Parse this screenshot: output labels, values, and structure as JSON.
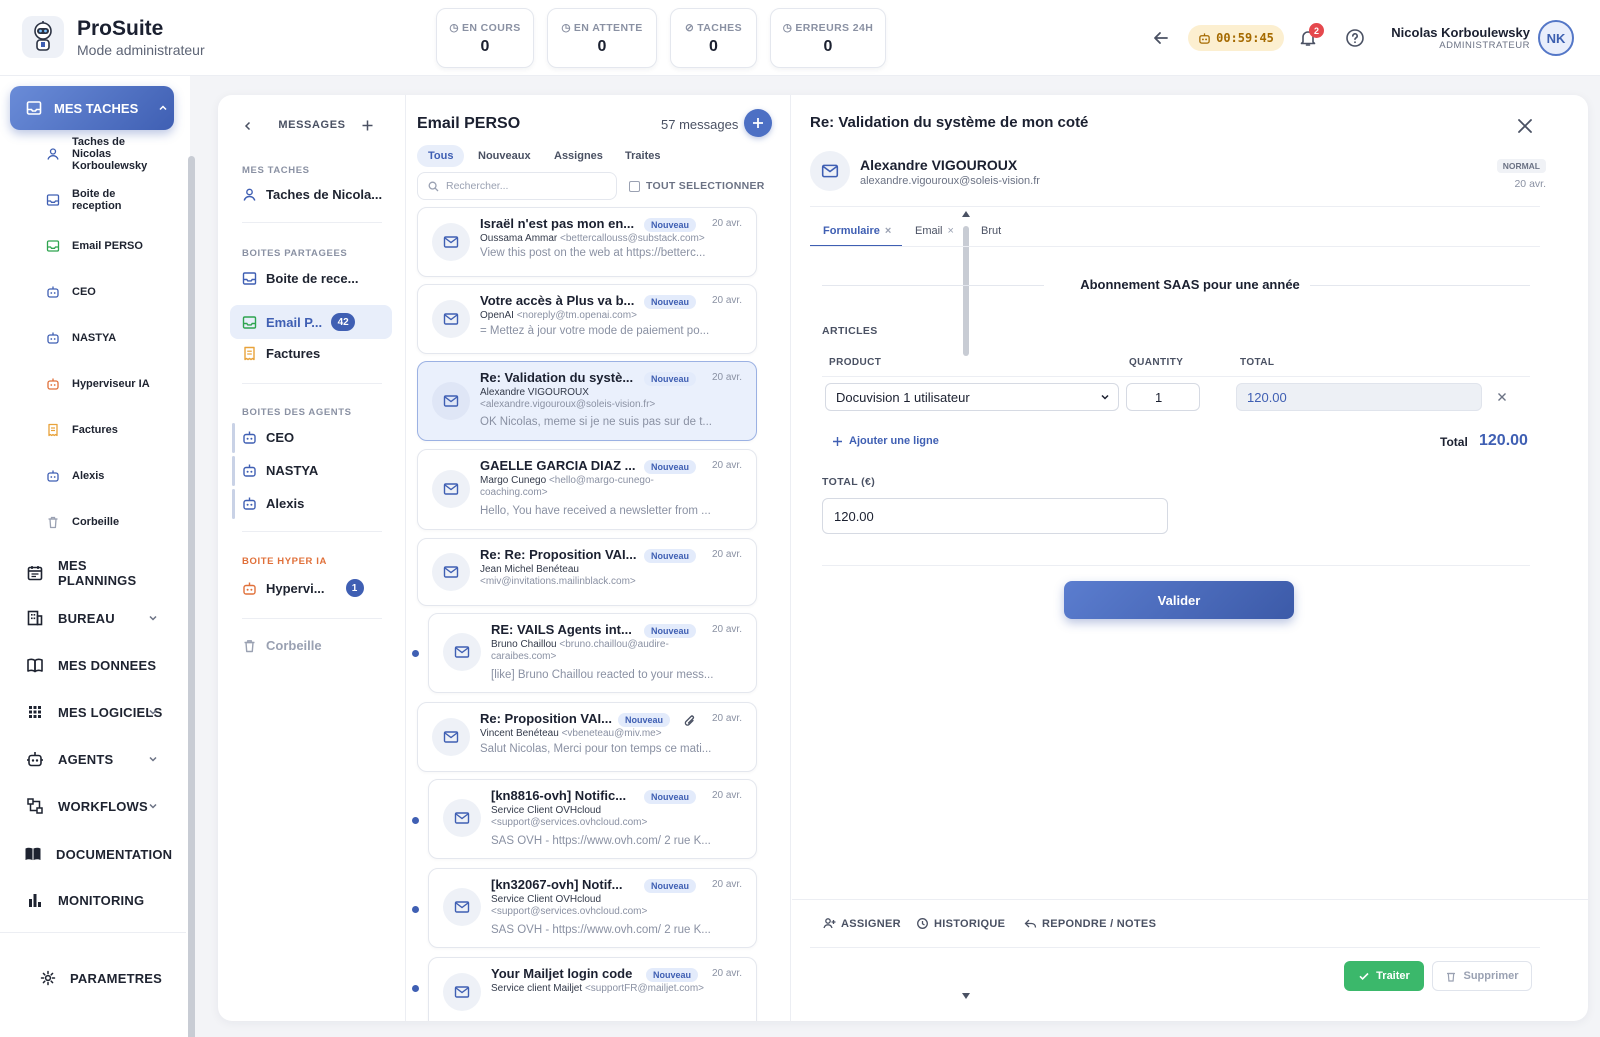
{
  "app": {
    "name": "ProSuite",
    "mode": "Mode administrateur"
  },
  "stats": [
    {
      "label": "EN COURS",
      "value": "0"
    },
    {
      "label": "EN ATTENTE",
      "value": "0"
    },
    {
      "label": "TACHES",
      "value": "0"
    },
    {
      "label": "ERREURS 24H",
      "value": "0"
    }
  ],
  "header": {
    "timer": "00:59:45",
    "notifications": "2",
    "user_name": "Nicolas Korboulewsky",
    "user_role": "ADMINISTRATEUR",
    "user_initials": "NK"
  },
  "sidebar": {
    "main": "MES TACHES",
    "sub_items": [
      {
        "label": "Taches de Nicolas Korboulewsky",
        "icon": "user-icon"
      },
      {
        "label": "Boite de reception",
        "icon": "inbox-icon"
      },
      {
        "label": "Email PERSO",
        "icon": "inbox-icon"
      },
      {
        "label": "CEO",
        "icon": "robot-icon"
      },
      {
        "label": "NASTYA",
        "icon": "robot-icon"
      },
      {
        "label": "Hyperviseur IA",
        "icon": "robot-icon"
      },
      {
        "label": "Factures",
        "icon": "receipt-icon"
      },
      {
        "label": "Alexis",
        "icon": "robot-icon"
      },
      {
        "label": "Corbeille",
        "icon": "trash-icon"
      }
    ],
    "items": [
      {
        "label": "MES PLANNINGS",
        "icon": "calendar-icon"
      },
      {
        "label": "BUREAU",
        "icon": "building-icon"
      },
      {
        "label": "MES DONNEES",
        "icon": "book-icon"
      },
      {
        "label": "MES LOGICIELS",
        "icon": "grid-icon"
      },
      {
        "label": "AGENTS",
        "icon": "robot-icon"
      },
      {
        "label": "WORKFLOWS",
        "icon": "workflow-icon"
      },
      {
        "label": "DOCUMENTATION",
        "icon": "doc-icon"
      },
      {
        "label": "MONITORING",
        "icon": "chart-icon"
      }
    ],
    "settings": "PARAMETRES"
  },
  "folders": {
    "title": "MESSAGES",
    "sec_tasks": "MES TACHES",
    "tasks_item": "Taches de Nicola...",
    "sec_shared": "BOITES PARTAGEES",
    "shared": [
      {
        "label": "Boite de rece...",
        "badge": ""
      },
      {
        "label": "Email P...",
        "badge": "42"
      },
      {
        "label": "Factures",
        "badge": ""
      }
    ],
    "sec_agents": "BOITES DES AGENTS",
    "agents": [
      "CEO",
      "NASTYA",
      "Alexis"
    ],
    "sec_hyper": "BOITE HYPER IA",
    "hyper": {
      "label": "Hypervi...",
      "badge": "1"
    },
    "trash": "Corbeille"
  },
  "list": {
    "title": "Email PERSO",
    "count": "57 messages",
    "tabs": [
      "Tous",
      "Nouveaux",
      "Assignes",
      "Traites"
    ],
    "search_placeholder": "Rechercher...",
    "select_all": "TOUT SELECTIONNER",
    "messages": [
      {
        "subject": "Israël n'est pas mon en...",
        "badge": "Nouveau",
        "date": "20 avr.",
        "from": "Oussama Ammar",
        "email": "<bettercallouss@substack.com>",
        "preview": "View this post on the web at https://betterc..."
      },
      {
        "subject": "Votre accès à Plus va b...",
        "badge": "Nouveau",
        "date": "20 avr.",
        "from": "OpenAI",
        "email": "<noreply@tm.openai.com>",
        "preview": "= Mettez à jour votre mode de paiement po..."
      },
      {
        "subject": "Re: Validation du systè...",
        "badge": "Nouveau",
        "date": "20 avr.",
        "from": "Alexandre VIGOUROUX",
        "email": "<alexandre.vigouroux@soleis-vision.fr>",
        "preview": "OK Nicolas, meme si je ne suis pas sur de t..."
      },
      {
        "subject": "GAELLE GARCIA DIAZ ...",
        "badge": "Nouveau",
        "date": "20 avr.",
        "from": "Margo Cunego",
        "email": "<hello@margo-cunego-coaching.com>",
        "preview": "Hello, You have received a newsletter from ..."
      },
      {
        "subject": "Re: Re: Proposition VAI...",
        "badge": "Nouveau",
        "date": "20 avr.",
        "from": "Jean Michel Benéteau",
        "email": "<miv@invitations.mailinblack.com>",
        "preview": ""
      },
      {
        "subject": "RE: VAILS Agents int...",
        "badge": "Nouveau",
        "date": "20 avr.",
        "from": "Bruno Chaillou",
        "email": "<bruno.chaillou@audire-caraibes.com>",
        "preview": "[like] Bruno Chaillou reacted to your mess..."
      },
      {
        "subject": "Re: Proposition VAI...",
        "badge": "Nouveau",
        "date": "20 avr.",
        "from": "Vincent Benéteau",
        "email": "<vbeneteau@miv.me>",
        "preview": "Salut Nicolas, Merci pour ton temps ce mati..."
      },
      {
        "subject": "[kn8816-ovh] Notific...",
        "badge": "Nouveau",
        "date": "20 avr.",
        "from": "Service Client OVHcloud",
        "email": "<support@services.ovhcloud.com>",
        "preview": "SAS OVH - https://www.ovh.com/ 2 rue K..."
      },
      {
        "subject": "[kn32067-ovh] Notif...",
        "badge": "Nouveau",
        "date": "20 avr.",
        "from": "Service Client OVHcloud",
        "email": "<support@services.ovhcloud.com>",
        "preview": "SAS OVH - https://www.ovh.com/ 2 rue K..."
      },
      {
        "subject": "Your Mailjet login code",
        "badge": "Nouveau",
        "date": "20 avr.",
        "from": "Service client Mailjet",
        "email": "<supportFR@mailjet.com>",
        "preview": ""
      }
    ]
  },
  "detail": {
    "title": "Re: Validation du système de mon coté",
    "sender_name": "Alexandre VIGOUROUX",
    "sender_email": "alexandre.vigouroux@soleis-vision.fr",
    "priority": "NORMAL",
    "date": "20 avr.",
    "tabs": [
      "Formulaire",
      "Email",
      "Brut"
    ],
    "form_title": "Abonnement SAAS pour une année",
    "articles_label": "ARTICLES",
    "col_product": "PRODUCT",
    "col_quantity": "QUANTITY",
    "col_total": "TOTAL",
    "product": "Docuvision 1 utilisateur",
    "quantity": "1",
    "line_total": "120.00",
    "add_line": "Ajouter une ligne",
    "total_label": "Total",
    "total_value": "120.00",
    "total_eur_label": "TOTAL (€)",
    "total_eur": "120.00",
    "validate": "Valider",
    "actions": [
      "ASSIGNER",
      "HISTORIQUE",
      "REPONDRE / NOTES"
    ],
    "treat": "Traiter",
    "delete": "Supprimer"
  },
  "colors": {
    "accent": "#3f5fb3",
    "success": "#3bb86b",
    "hyper": "#e0703a",
    "inbox_green": "#2ea44f",
    "receipt": "#e8a23a"
  }
}
